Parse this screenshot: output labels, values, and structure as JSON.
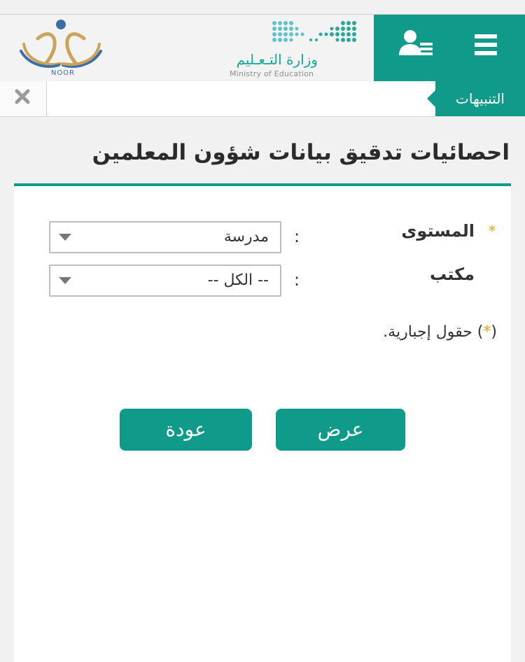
{
  "header": {
    "ministry_name_ar": "وزارة التـعـليم",
    "ministry_name_en": "Ministry of Education",
    "noor_label": "NOOR",
    "menu_icon": "hamburger-menu-icon",
    "user_icon": "user-list-icon"
  },
  "alerts": {
    "label": "التنبيهات",
    "close_icon": "close-icon"
  },
  "page": {
    "title": "احصائيات تدقيق بيانات شؤون المعلمين"
  },
  "form": {
    "fields": [
      {
        "label": "المستوى",
        "required": true,
        "required_mark": "*",
        "colon": ":",
        "value": "مدرسة"
      },
      {
        "label": "مكتب",
        "required": false,
        "colon": ":",
        "value": "-- الكل --"
      }
    ],
    "required_note_open": "(",
    "required_note_star": "*",
    "required_note_text": ") حقول إجبارية."
  },
  "buttons": {
    "submit_label": "عرض",
    "back_label": "عودة"
  },
  "colors": {
    "brand": "#0f9a8a",
    "required_star": "#e8a01a",
    "noor_blue": "#3c6fa6",
    "noor_gold": "#c9a45a"
  }
}
